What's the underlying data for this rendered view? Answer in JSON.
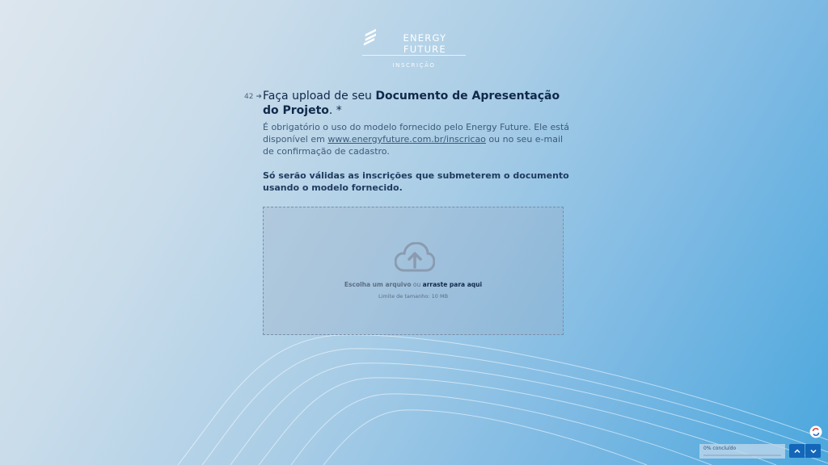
{
  "brand": {
    "name": "ENERGY FUTURE",
    "subtitle": "INSCRIÇÃO"
  },
  "question": {
    "number": "42",
    "title_prefix": "Faça upload de seu ",
    "title_bold": "Documento de Apresentação do Projeto",
    "title_suffix": ". *",
    "description_before_link": "É obrigatório o uso do modelo fornecido pelo Energy Future. Ele está disponível em ",
    "description_link": "www.energyfuture.com.br/inscricao",
    "description_after_link": " ou no seu e-mail de confirmação de cadastro.",
    "note": "Só serão válidas as inscrições que submeterem o documento usando o modelo fornecido."
  },
  "upload": {
    "choose_label": "Escolha um arquivo",
    "or_label": " ou ",
    "drag_label": "arraste para aqui",
    "limit_label": "Limite de tamanho: 10 MB",
    "icon": "cloud-upload-icon"
  },
  "footer": {
    "progress_label": "0% concluído",
    "progress_value": 0,
    "help_icon": "help-icon"
  },
  "colors": {
    "accent": "#1466b8",
    "title": "#10284a",
    "description": "#3c5a7a"
  }
}
